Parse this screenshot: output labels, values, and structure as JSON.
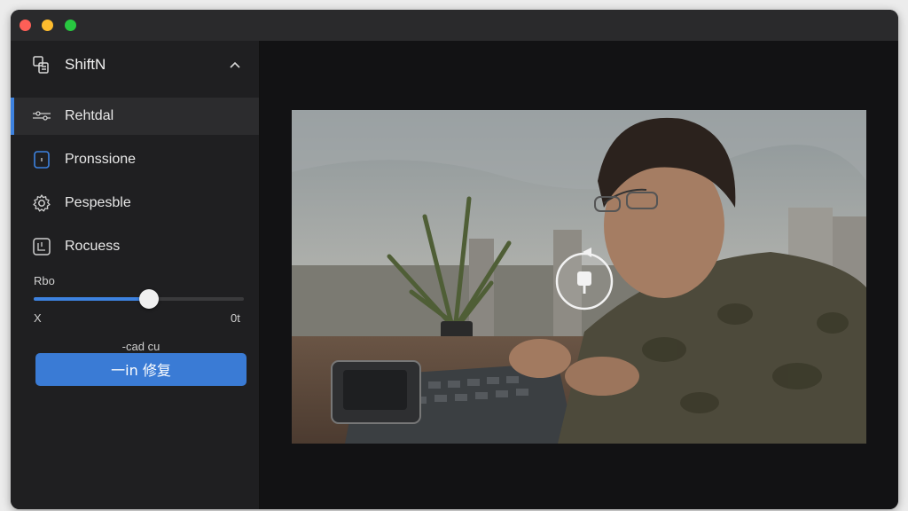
{
  "window": {
    "controls": [
      "close",
      "minimize",
      "maximize"
    ]
  },
  "sidebar": {
    "app_title": "ShiftN",
    "header_icon": "document-transform-icon",
    "items": [
      {
        "label": "Rehtdal",
        "icon": "sliders-icon",
        "active": true
      },
      {
        "label": "Pronssione",
        "icon": "file-icon",
        "active": false
      },
      {
        "label": "Pespesble",
        "icon": "gear-icon",
        "active": false
      },
      {
        "label": "Rocuess",
        "icon": "crop-icon",
        "active": false
      }
    ],
    "slider": {
      "label": "Rbo",
      "min_label": "X",
      "max_label": "0t",
      "value": 0.55
    },
    "caption": "-cad cu",
    "primary_button": "一in 修复"
  },
  "colors": {
    "accent": "#3d82e0",
    "button": "#3a7bd5"
  }
}
